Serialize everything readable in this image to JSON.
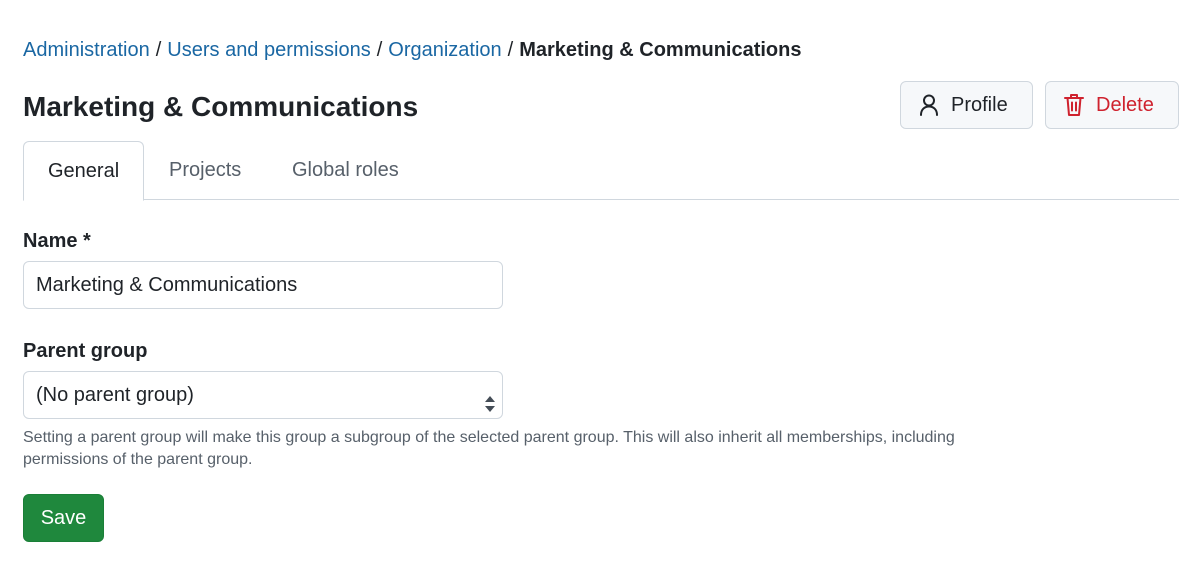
{
  "breadcrumb": {
    "items": [
      "Administration",
      "Users and permissions",
      "Organization"
    ],
    "separator": "/",
    "current": "Marketing & Communications"
  },
  "header": {
    "title": "Marketing & Communications",
    "profile_label": "Profile",
    "delete_label": "Delete",
    "profile_icon": "user-icon",
    "delete_icon": "trash-icon"
  },
  "tabs": [
    {
      "label": "General",
      "active": true
    },
    {
      "label": "Projects",
      "active": false
    },
    {
      "label": "Global roles",
      "active": false
    }
  ],
  "form": {
    "name_label": "Name *",
    "name_value": "Marketing & Communications",
    "parent_label": "Parent group",
    "parent_value": "(No parent group)",
    "parent_hint": "Setting a parent group will make this group a subgroup of the selected parent group. This will also inherit all memberships, including permissions of the parent group.",
    "save_label": "Save"
  },
  "colors": {
    "link": "#1a67a3",
    "danger": "#cf222e",
    "primary": "#1f883d"
  }
}
